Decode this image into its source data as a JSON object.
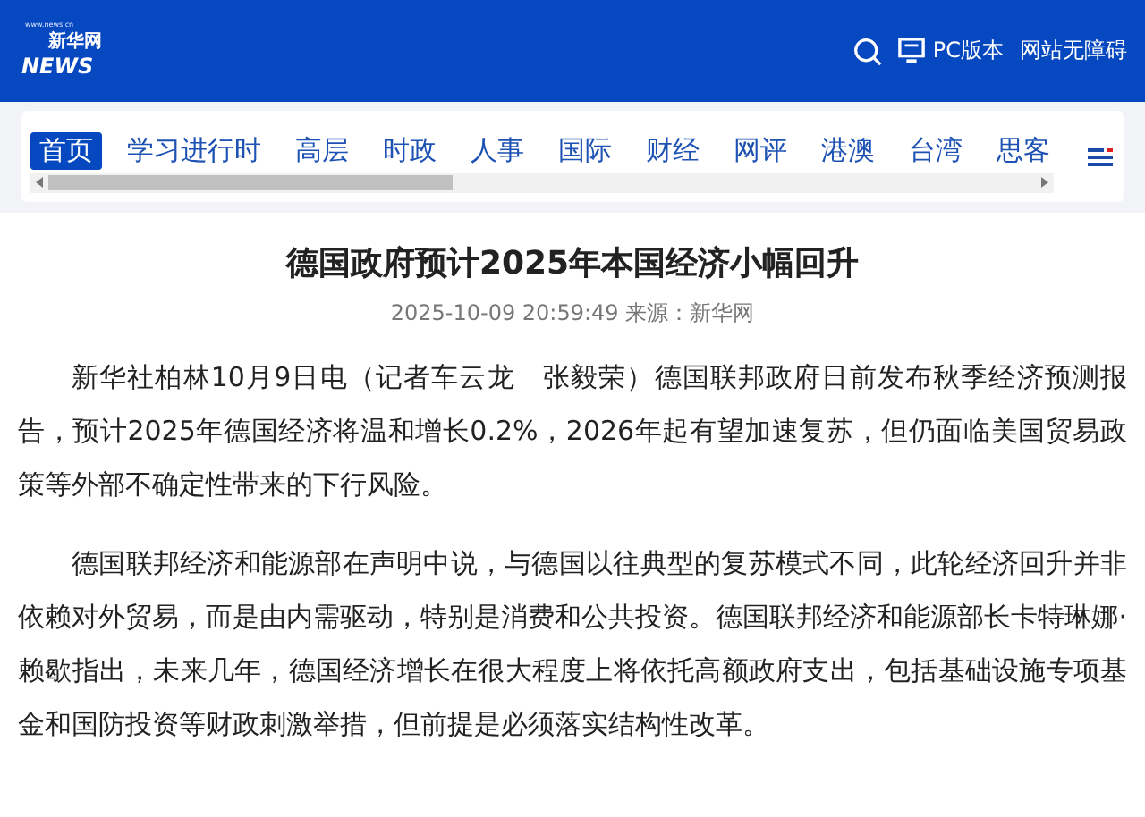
{
  "header": {
    "logo": {
      "site": "新华网",
      "word": "NEWS",
      "url": "www.news.cn"
    },
    "links": [
      {
        "kind": "search"
      },
      {
        "kind": "pc",
        "label": "PC版本"
      },
      {
        "kind": "text",
        "label": "网站无障碍"
      }
    ]
  },
  "nav": {
    "tabs": [
      {
        "label": "首页",
        "selected": true
      },
      {
        "label": "学习进行时",
        "selected": false
      },
      {
        "label": "高层",
        "selected": false
      },
      {
        "label": "时政",
        "selected": false
      },
      {
        "label": "人事",
        "selected": false
      },
      {
        "label": "国际",
        "selected": false
      },
      {
        "label": "财经",
        "selected": false
      },
      {
        "label": "网评",
        "selected": false
      },
      {
        "label": "港澳",
        "selected": false
      },
      {
        "label": "台湾",
        "selected": false
      },
      {
        "label": "思客",
        "selected": false
      }
    ]
  },
  "article": {
    "title": "德国政府预计2025年本国经济小幅回升",
    "meta": "2025-10-09 20:59:49 来源：新华网",
    "paragraphs": [
      "新华社柏林10月9日电（记者车云龙　张毅荣）德国联邦政府日前发布秋季经济预测报告，预计2025年德国经济将温和增长0.2%，2026年起有望加速复苏，但仍面临美国贸易政策等外部不确定性带来的下行风险。",
      "德国联邦经济和能源部在声明中说，与德国以往典型的复苏模式不同，此轮经济回升并非依赖对外贸易，而是由内需驱动，特别是消费和公共投资。德国联邦经济和能源部长卡特琳娜·赖歇指出，未来几年，德国经济增长在很大程度上将依托高额政府支出，包括基础设施专项基金和国防投资等财政刺激举措，但前提是必须落实结构性改革。"
    ]
  }
}
